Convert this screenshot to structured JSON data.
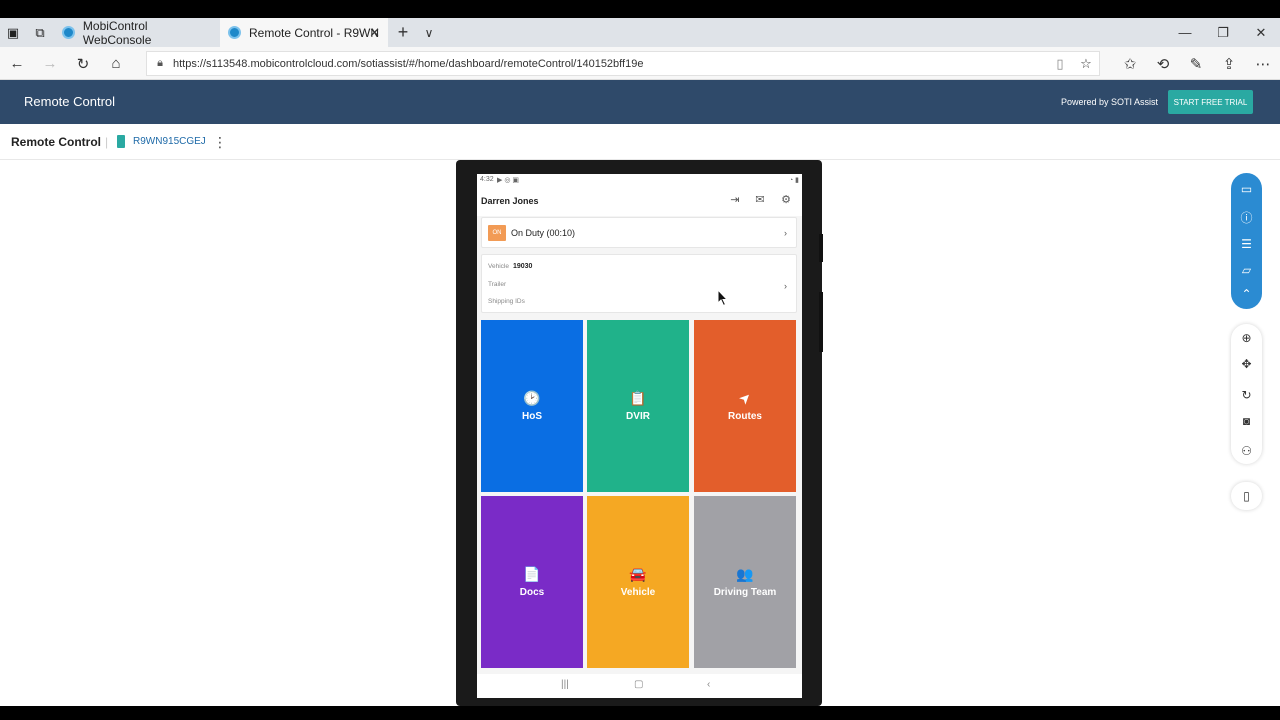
{
  "browser": {
    "tabs": [
      {
        "label": "MobiControl WebConsole",
        "active": false
      },
      {
        "label": "Remote Control - R9WN",
        "active": true
      }
    ],
    "url": "https://s113548.mobicontrolcloud.com/sotiassist/#/home/dashboard/remoteControl/140152bff19e"
  },
  "app": {
    "title": "Remote Control",
    "powered_by": "Powered by SOTI Assist",
    "trial_label": "START FREE TRIAL"
  },
  "subheader": {
    "title": "Remote Control",
    "device_name": "R9WN915CGEJ"
  },
  "phone": {
    "status_time": "4:32",
    "user_name": "Darren Jones",
    "duty": {
      "badge": "ON",
      "label": "On Duty (00:10)"
    },
    "vehicle_card": {
      "vehicle_label": "Vehicle",
      "vehicle_value": "19030",
      "trailer_label": "Trailer",
      "shipping_label": "Shipping IDs"
    },
    "tiles": [
      {
        "label": "HoS",
        "color": "#0a6ee3",
        "icon": "clock-icon",
        "glyph": "🕑"
      },
      {
        "label": "DVIR",
        "color": "#20b28a",
        "icon": "clipboard-icon",
        "glyph": "📋"
      },
      {
        "label": "Routes",
        "color": "#e35e2b",
        "icon": "navigation-arrow-icon",
        "glyph": "➤"
      },
      {
        "label": "Docs",
        "color": "#7a2bc7",
        "icon": "document-icon",
        "glyph": "📄"
      },
      {
        "label": "Vehicle",
        "color": "#f5a823",
        "icon": "car-icon",
        "glyph": "🚘"
      },
      {
        "label": "Driving Team",
        "color": "#a1a1a6",
        "icon": "people-icon",
        "glyph": "👥"
      }
    ]
  },
  "colors": {
    "appbar": "#2f4a6a",
    "accent_teal": "#2aa9a2",
    "toolbar_blue": "#2b8bd2"
  }
}
